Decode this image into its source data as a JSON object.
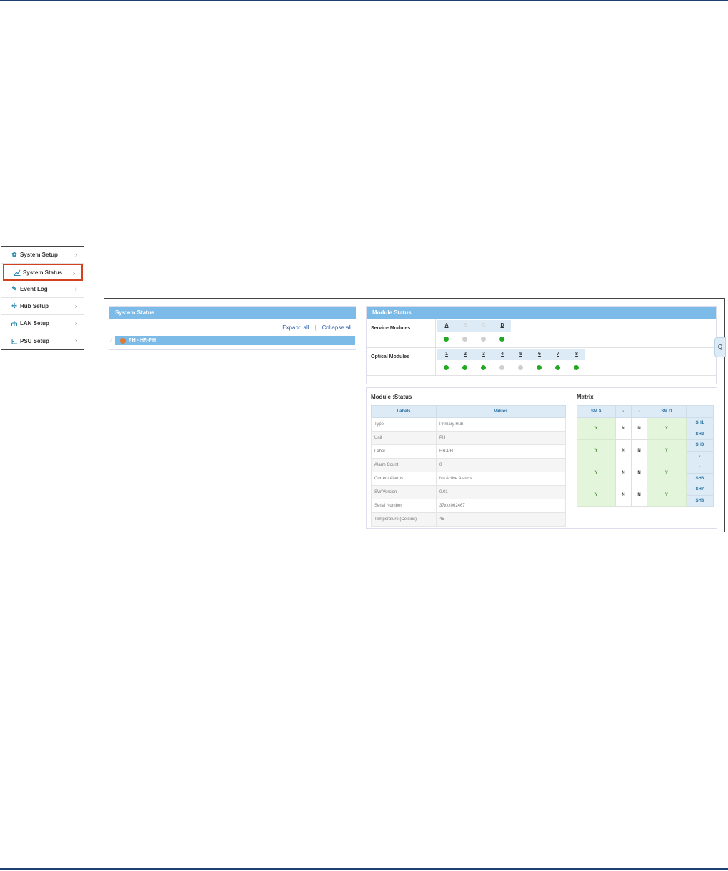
{
  "sidebar": {
    "items": [
      {
        "label": "System Setup",
        "icon": "gear-icon"
      },
      {
        "label": "System Status",
        "icon": "chart-line-icon"
      },
      {
        "label": "Event Log",
        "icon": "edit-icon"
      },
      {
        "label": "Hub Setup",
        "icon": "hub-icon"
      },
      {
        "label": "LAN Setup",
        "icon": "network-icon"
      },
      {
        "label": "PSU Setup",
        "icon": "power-icon"
      }
    ],
    "active_index": 1,
    "highlight_color": "#d2421c"
  },
  "system_status": {
    "title": "System Status",
    "expand_all": "Expand all",
    "separator": "|",
    "collapse_all": "Collapse all",
    "tree_row": "PH - HR-PH",
    "tree_row_dot_color": "#e07a30"
  },
  "module_status_top": {
    "title": "Module Status",
    "service_label": "Service Modules",
    "service_slots": [
      {
        "label": "A",
        "state": "on",
        "present": true
      },
      {
        "label": "B",
        "state": "off",
        "present": false
      },
      {
        "label": "C",
        "state": "off",
        "present": false
      },
      {
        "label": "D",
        "state": "on",
        "present": true
      }
    ],
    "optical_label": "Optical Modules",
    "optical_slots": [
      {
        "label": "1",
        "state": "on"
      },
      {
        "label": "2",
        "state": "on"
      },
      {
        "label": "3",
        "state": "on"
      },
      {
        "label": "4",
        "state": "off"
      },
      {
        "label": "5",
        "state": "off"
      },
      {
        "label": "6",
        "state": "on"
      },
      {
        "label": "7",
        "state": "on"
      },
      {
        "label": "8",
        "state": "on"
      }
    ],
    "side_tab": "Q"
  },
  "module_detail": {
    "title": "Module :Status",
    "headers": [
      "Labels",
      "Values"
    ],
    "rows": [
      [
        "Type",
        "Primary Hub"
      ],
      [
        "Unit",
        "PH"
      ],
      [
        "Label",
        "HR-PH"
      ],
      [
        "Alarm Count",
        "0"
      ],
      [
        "Current Alarms",
        "No Active Alarms"
      ],
      [
        "SW Version",
        "0.01"
      ],
      [
        "Serial Number",
        "37xxx062467"
      ],
      [
        "Temperature (Celsius)",
        "45"
      ]
    ]
  },
  "matrix": {
    "title": "Matrix",
    "headers": [
      "SM A",
      "-",
      "-",
      "SM D",
      ""
    ],
    "rows": [
      {
        "cells": [
          "Y",
          "N",
          "N",
          "Y"
        ],
        "sh": [
          "SH1",
          "SH2"
        ]
      },
      {
        "cells": [
          "Y",
          "N",
          "N",
          "Y"
        ],
        "sh": [
          "SH3",
          "-"
        ]
      },
      {
        "cells": [
          "Y",
          "N",
          "N",
          "Y"
        ],
        "sh": [
          "-",
          "SH6"
        ]
      },
      {
        "cells": [
          "Y",
          "N",
          "N",
          "Y"
        ],
        "sh": [
          "SH7",
          "SH8"
        ]
      }
    ]
  },
  "colors": {
    "accent_header": "#7cbbe8",
    "led_on": "#22a822",
    "led_off": "#cfcfcf",
    "rule": "#1f3f73"
  }
}
